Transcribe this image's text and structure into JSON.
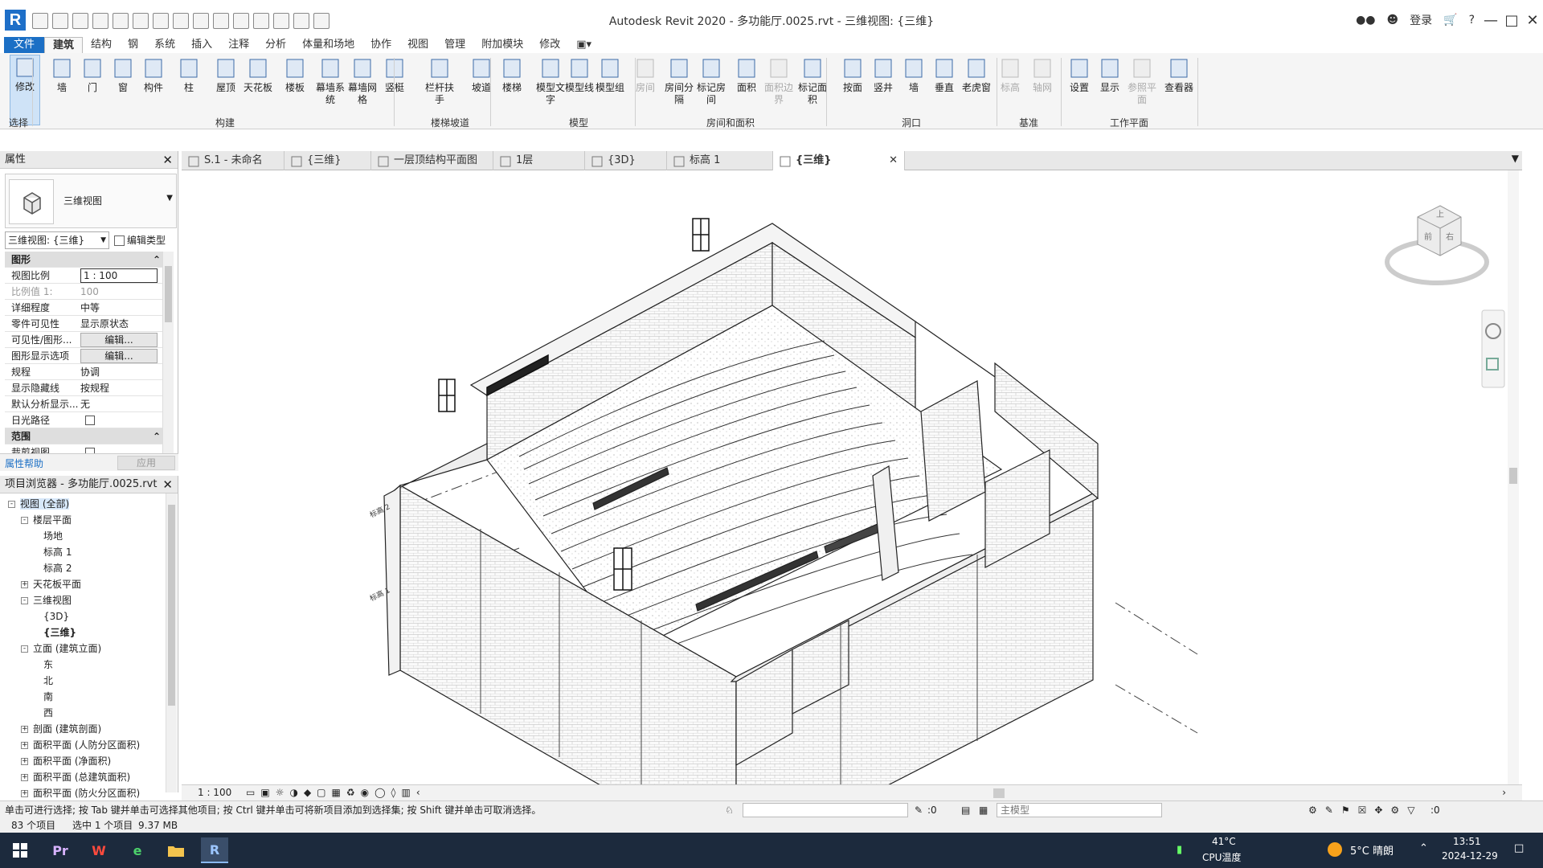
{
  "window": {
    "title": "Autodesk Revit 2020 - 多功能厅.0025.rvt - 三维视图: {三维}",
    "login": "登录",
    "help": "?"
  },
  "menu": {
    "tabs": [
      "文件",
      "建筑",
      "结构",
      "钢",
      "系统",
      "插入",
      "注释",
      "分析",
      "体量和场地",
      "协作",
      "视图",
      "管理",
      "附加模块",
      "修改"
    ],
    "active": "建筑"
  },
  "ribbon": {
    "tools": [
      {
        "label": "修改",
        "icon": "cursor-icon"
      },
      {
        "label": "墙",
        "icon": "wall-icon"
      },
      {
        "label": "门",
        "icon": "door-icon"
      },
      {
        "label": "窗",
        "icon": "window-icon"
      },
      {
        "label": "构件",
        "icon": "component-icon"
      },
      {
        "label": "柱",
        "icon": "column-icon"
      },
      {
        "label": "屋顶",
        "icon": "roof-icon"
      },
      {
        "label": "天花板",
        "icon": "ceiling-icon"
      },
      {
        "label": "楼板",
        "icon": "floor-icon"
      },
      {
        "label": "幕墙系统",
        "icon": "curtain-system-icon"
      },
      {
        "label": "幕墙网格",
        "icon": "curtain-grid-icon"
      },
      {
        "label": "竖梃",
        "icon": "mullion-icon"
      },
      {
        "label": "栏杆扶手",
        "icon": "railing-icon"
      },
      {
        "label": "坡道",
        "icon": "ramp-icon"
      },
      {
        "label": "楼梯",
        "icon": "stair-icon"
      },
      {
        "label": "模型文字",
        "icon": "model-text-icon"
      },
      {
        "label": "模型线",
        "icon": "model-line-icon"
      },
      {
        "label": "模型组",
        "icon": "model-group-icon"
      },
      {
        "label": "房间",
        "icon": "room-icon"
      },
      {
        "label": "房间分隔",
        "icon": "room-separator-icon"
      },
      {
        "label": "标记房间",
        "icon": "tag-room-icon"
      },
      {
        "label": "面积",
        "icon": "area-icon"
      },
      {
        "label": "面积边界",
        "icon": "area-boundary-icon"
      },
      {
        "label": "标记面积",
        "icon": "tag-area-icon"
      },
      {
        "label": "按面",
        "icon": "by-face-icon"
      },
      {
        "label": "竖井",
        "icon": "shaft-icon"
      },
      {
        "label": "墙",
        "icon": "wall-opening-icon"
      },
      {
        "label": "垂直",
        "icon": "vertical-opening-icon"
      },
      {
        "label": "老虎窗",
        "icon": "dormer-icon"
      },
      {
        "label": "标高",
        "icon": "level-icon"
      },
      {
        "label": "轴网",
        "icon": "grid-icon"
      },
      {
        "label": "设置",
        "icon": "set-plane-icon"
      },
      {
        "label": "显示",
        "icon": "show-plane-icon"
      },
      {
        "label": "参照平面",
        "icon": "ref-plane-icon"
      },
      {
        "label": "查看器",
        "icon": "viewer-icon"
      }
    ],
    "panels": [
      "选择",
      "构建",
      "楼梯坡道",
      "模型",
      "房间和面积",
      "洞口",
      "基准",
      "工作平面"
    ]
  },
  "properties": {
    "title": "属性",
    "type_name": "三维视图",
    "view_selector": "三维视图: {三维}",
    "edit_type": "编辑类型",
    "section_graphics": "图形",
    "section_extent": "范围",
    "rows": [
      {
        "key": "视图比例",
        "value": "1 : 100"
      },
      {
        "key": "比例值 1:",
        "value": "100"
      },
      {
        "key": "详细程度",
        "value": "中等"
      },
      {
        "key": "零件可见性",
        "value": "显示原状态"
      },
      {
        "key": "可见性/图形...",
        "value": "编辑..."
      },
      {
        "key": "图形显示选项",
        "value": "编辑..."
      },
      {
        "key": "规程",
        "value": "协调"
      },
      {
        "key": "显示隐藏线",
        "value": "按规程"
      },
      {
        "key": "默认分析显示...",
        "value": "无"
      },
      {
        "key": "日光路径",
        "value": ""
      },
      {
        "key": "裁剪视图",
        "value": ""
      }
    ],
    "help_link": "属性帮助",
    "apply": "应用"
  },
  "browser": {
    "title": "项目浏览器 - 多功能厅.0025.rvt",
    "nodes": [
      {
        "label": "视图 (全部)",
        "level": 0,
        "exp": "-"
      },
      {
        "label": "楼层平面",
        "level": 1,
        "exp": "-"
      },
      {
        "label": "场地",
        "level": 2,
        "exp": ""
      },
      {
        "label": "标高 1",
        "level": 2,
        "exp": ""
      },
      {
        "label": "标高 2",
        "level": 2,
        "exp": ""
      },
      {
        "label": "天花板平面",
        "level": 1,
        "exp": "+"
      },
      {
        "label": "三维视图",
        "level": 1,
        "exp": "-"
      },
      {
        "label": "{3D}",
        "level": 2,
        "exp": ""
      },
      {
        "label": "{三维}",
        "level": 2,
        "exp": "",
        "bold": true
      },
      {
        "label": "立面 (建筑立面)",
        "level": 1,
        "exp": "-"
      },
      {
        "label": "东",
        "level": 2,
        "exp": ""
      },
      {
        "label": "北",
        "level": 2,
        "exp": ""
      },
      {
        "label": "南",
        "level": 2,
        "exp": ""
      },
      {
        "label": "西",
        "level": 2,
        "exp": ""
      },
      {
        "label": "剖面 (建筑剖面)",
        "level": 1,
        "exp": "+"
      },
      {
        "label": "面积平面 (人防分区面积)",
        "level": 1,
        "exp": "+"
      },
      {
        "label": "面积平面 (净面积)",
        "level": 1,
        "exp": "+"
      },
      {
        "label": "面积平面 (总建筑面积)",
        "level": 1,
        "exp": "+"
      },
      {
        "label": "面积平面 (防火分区面积)",
        "level": 1,
        "exp": "+"
      }
    ]
  },
  "view_tabs": [
    {
      "label": "S.1 - 未命名",
      "active": false
    },
    {
      "label": "{三维}",
      "active": false
    },
    {
      "label": "一层顶结构平面图",
      "active": false
    },
    {
      "label": "1层",
      "active": false
    },
    {
      "label": "{3D}",
      "active": false
    },
    {
      "label": "标高 1",
      "active": false
    },
    {
      "label": "{三维}",
      "active": true
    }
  ],
  "viewcube": {
    "top": "上",
    "front": "前",
    "right": "右"
  },
  "level_labels": {
    "level2": "标高 2",
    "level1": "标高 1"
  },
  "view_control": {
    "scale": "1 : 100"
  },
  "status": {
    "message": "单击可进行选择; 按 Tab 键并单击可选择其他项目; 按 Ctrl 键并单击可将新项目添加到选择集; 按 Shift 键并单击可取消选择。",
    "workset_count": ":0",
    "design_option": "主模型",
    "filter_count": ":0",
    "items": "83 个项目",
    "selected": "选中 1 个项目",
    "size": "9.37 MB"
  },
  "taskbar": {
    "apps": [
      "Pr",
      "W",
      "e",
      "folder",
      "R"
    ],
    "cpu_temp": "41°C",
    "cpu_label": "CPU温度",
    "weather": "5°C 晴朗",
    "time": "13:51",
    "date": "2024-12-29"
  }
}
